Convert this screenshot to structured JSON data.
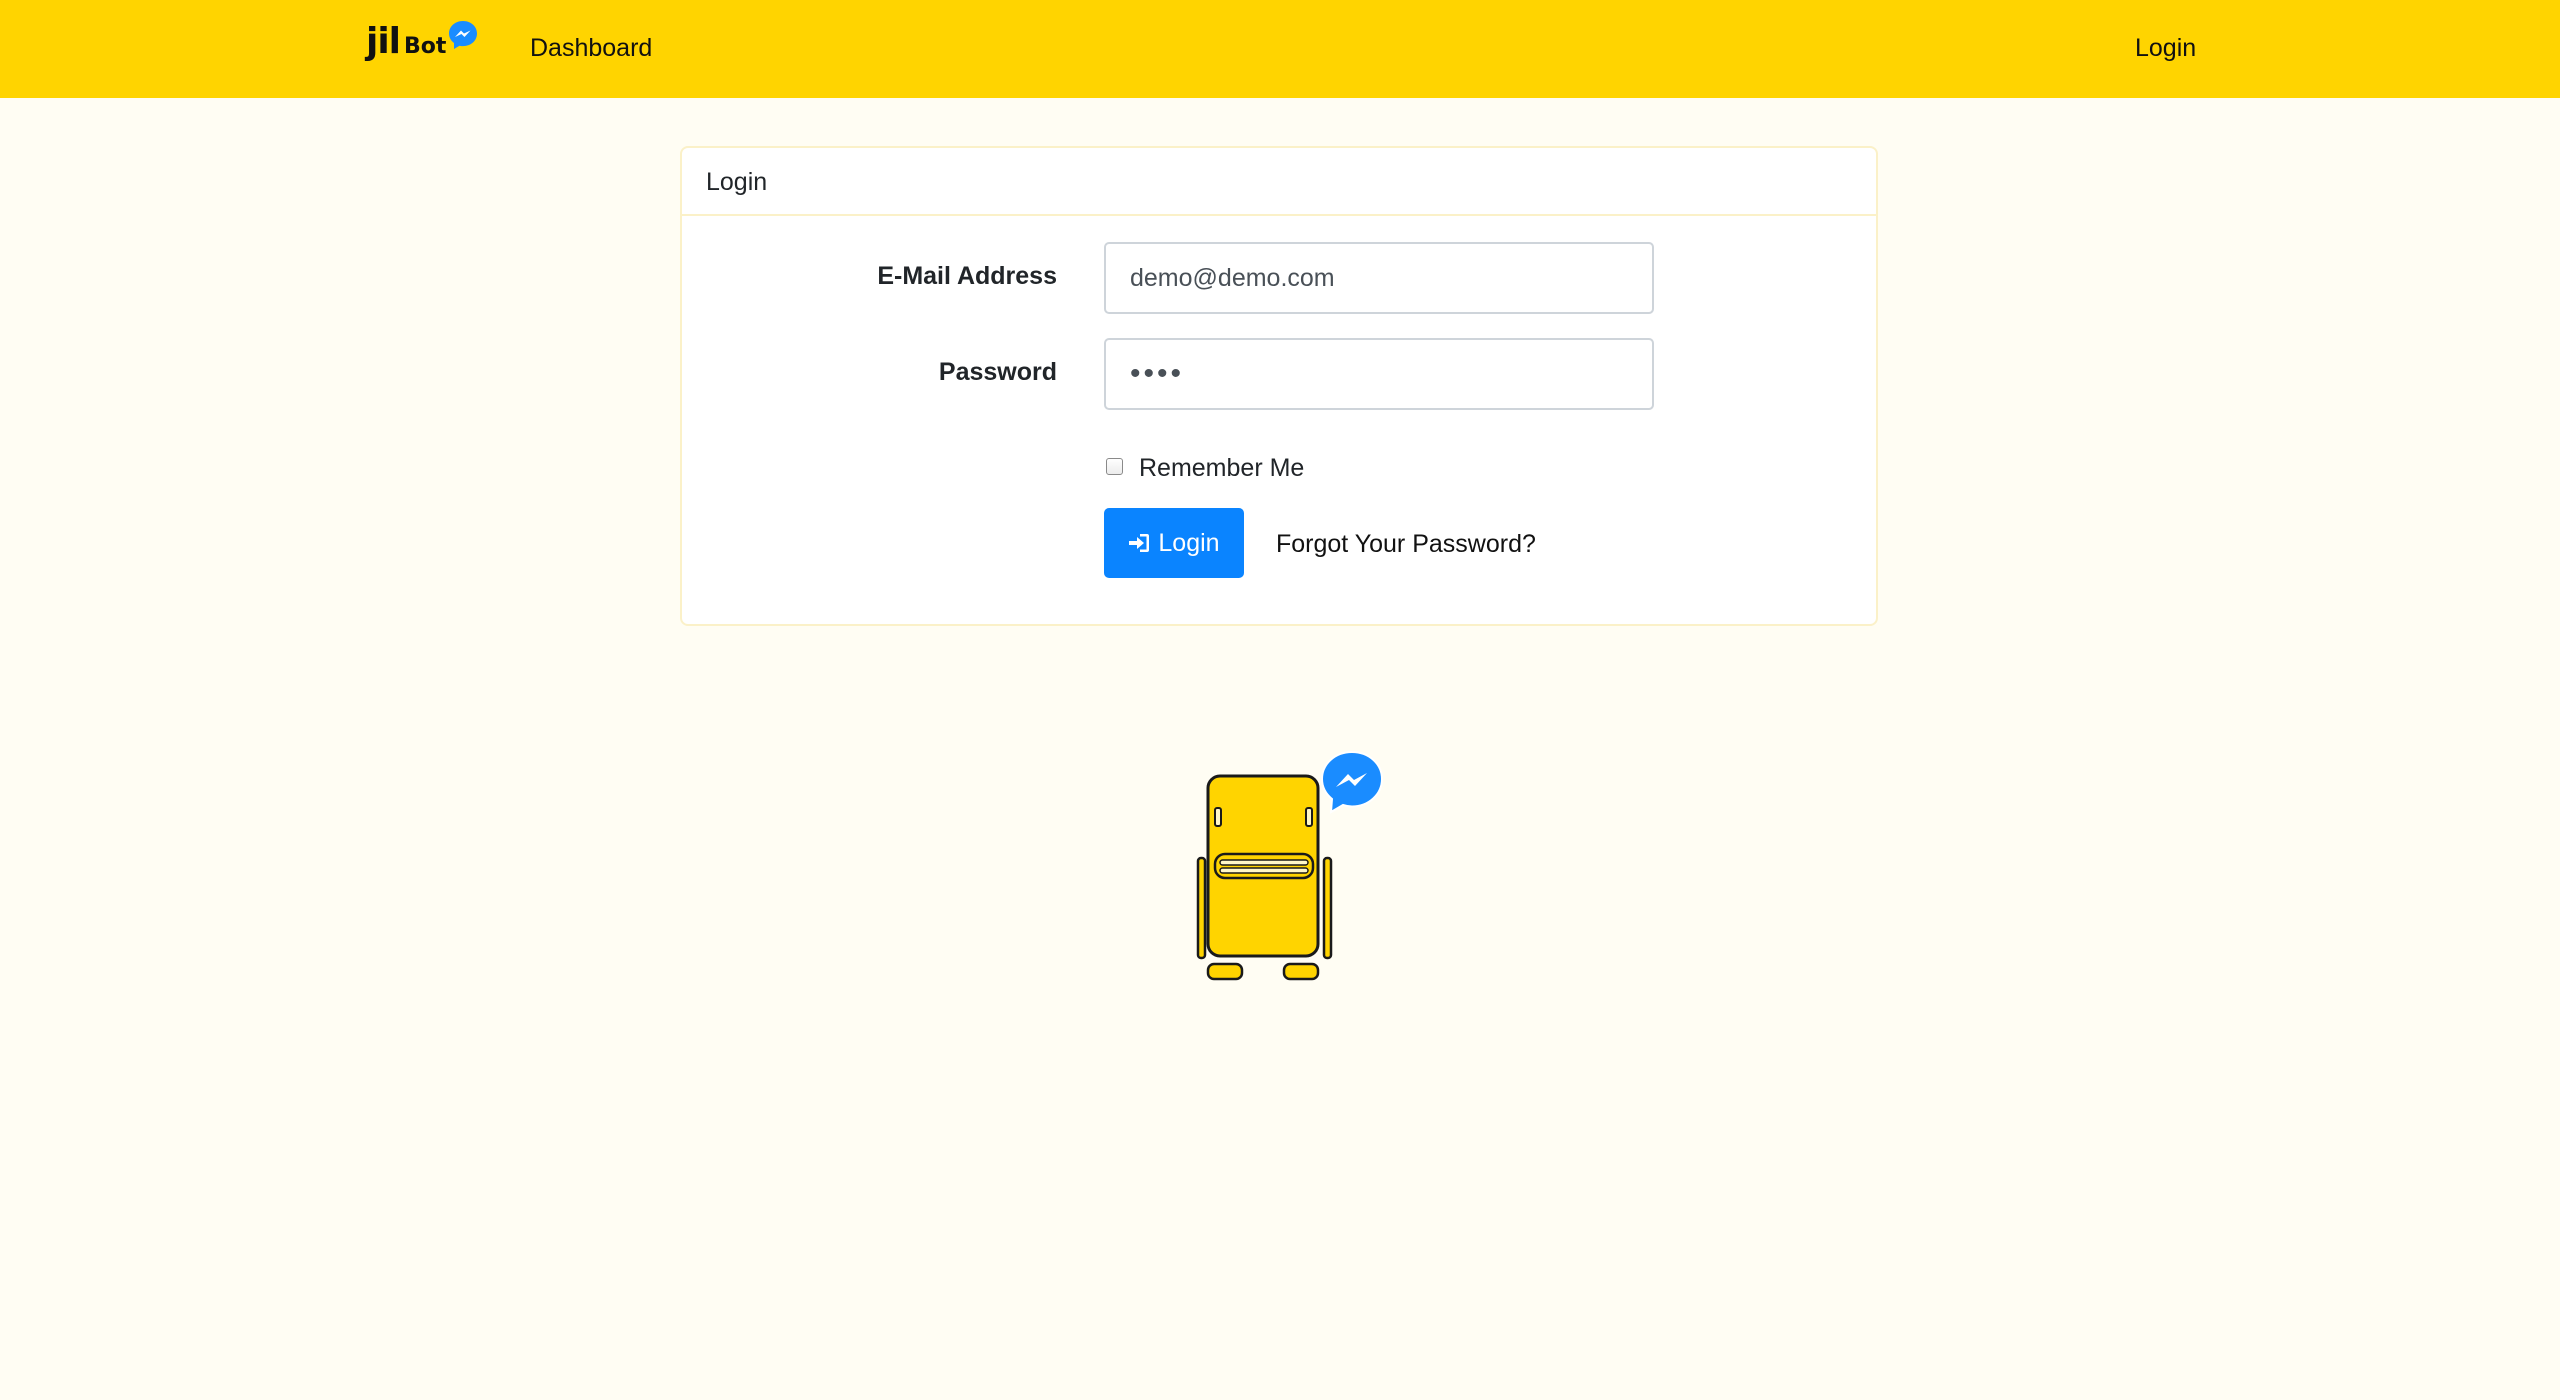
{
  "navbar": {
    "brand_main": "jil",
    "brand_sub": "Bot",
    "dashboard_label": "Dashboard",
    "login_label": "Login",
    "background_color": "#ffd400"
  },
  "card": {
    "header": "Login",
    "email_label": "E-Mail Address",
    "email_value": "demo@demo.com",
    "password_label": "Password",
    "password_value": "demo",
    "remember_label": "Remember Me",
    "remember_checked": false,
    "login_button_label": "Login",
    "forgot_label": "Forgot Your Password?"
  },
  "icons": {
    "brand_badge": "messenger-icon",
    "login_button": "sign-in-icon",
    "mascot_bubble": "messenger-icon"
  },
  "colors": {
    "accent": "#ffd400",
    "primary": "#0a84ff",
    "page_background": "#fffdf3",
    "messenger": "#1a8cff"
  }
}
